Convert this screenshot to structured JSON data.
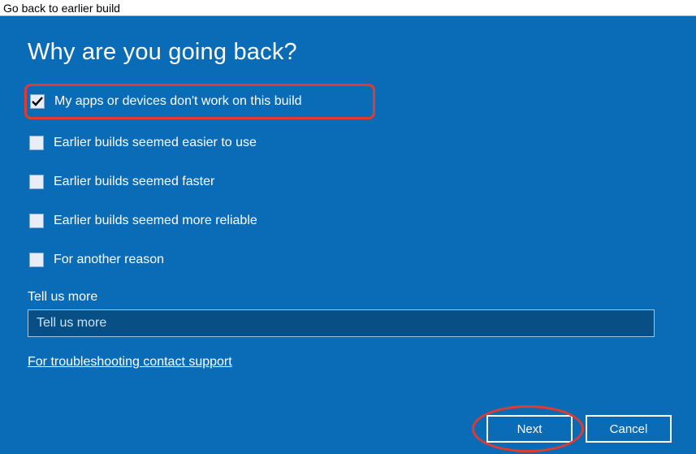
{
  "window": {
    "title": "Go back to earlier build"
  },
  "heading": "Why are you going back?",
  "options": [
    {
      "label": "My apps or devices don't work on this build",
      "checked": true,
      "highlighted": true
    },
    {
      "label": "Earlier builds seemed easier to use",
      "checked": false,
      "highlighted": false
    },
    {
      "label": "Earlier builds seemed faster",
      "checked": false,
      "highlighted": false
    },
    {
      "label": "Earlier builds seemed more reliable",
      "checked": false,
      "highlighted": false
    },
    {
      "label": "For another reason",
      "checked": false,
      "highlighted": false
    }
  ],
  "tell_us_more": {
    "label": "Tell us more",
    "placeholder": "Tell us more",
    "value": ""
  },
  "support_link": "For troubleshooting contact support",
  "buttons": {
    "next": "Next",
    "cancel": "Cancel"
  },
  "annotations": {
    "next_circled": true
  }
}
